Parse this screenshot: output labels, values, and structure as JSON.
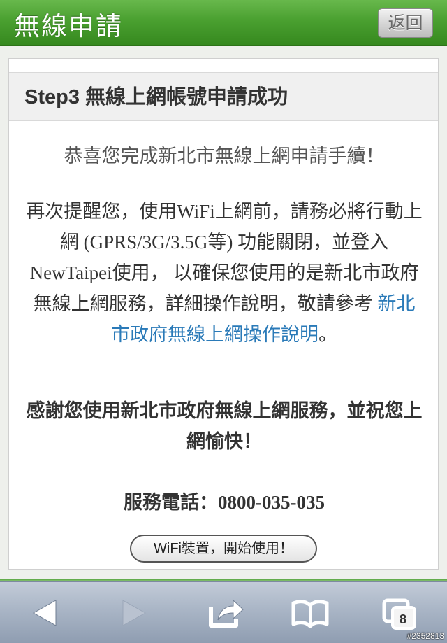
{
  "header": {
    "title": "無線申請",
    "back_label": "返回"
  },
  "card": {
    "title": "Step3 無線上網帳號申請成功",
    "congrats": "恭喜您完成新北市無線上網申請手續！",
    "reminder_text": "再次提醒您，使用WiFi上網前，請務必將行動上網 (GPRS/3G/3.5G等) 功能關閉，並登入NewTaipei使用， 以確保您使用的是新北市政府無線上網服務，詳細操作說明，敬請參考 ",
    "reminder_link": "新北市政府無線上網操作說明",
    "reminder_end": "。",
    "thanks": "感謝您使用新北市政府無線上網服務，並祝您上網愉快！",
    "phone": "服務電話：0800-035-035",
    "start_button": "WiFi裝置，開始使用！"
  },
  "toolbar": {
    "tabs_count": "8",
    "icons": [
      "back-arrow-icon",
      "forward-arrow-icon",
      "share-icon",
      "bookmarks-icon",
      "tabs-icon"
    ]
  },
  "watermark": "#2352813",
  "colors": {
    "header_green": "#4aa030",
    "link_blue": "#2a7ab8",
    "toolbar_blue_gray": "#a7b3c4"
  }
}
